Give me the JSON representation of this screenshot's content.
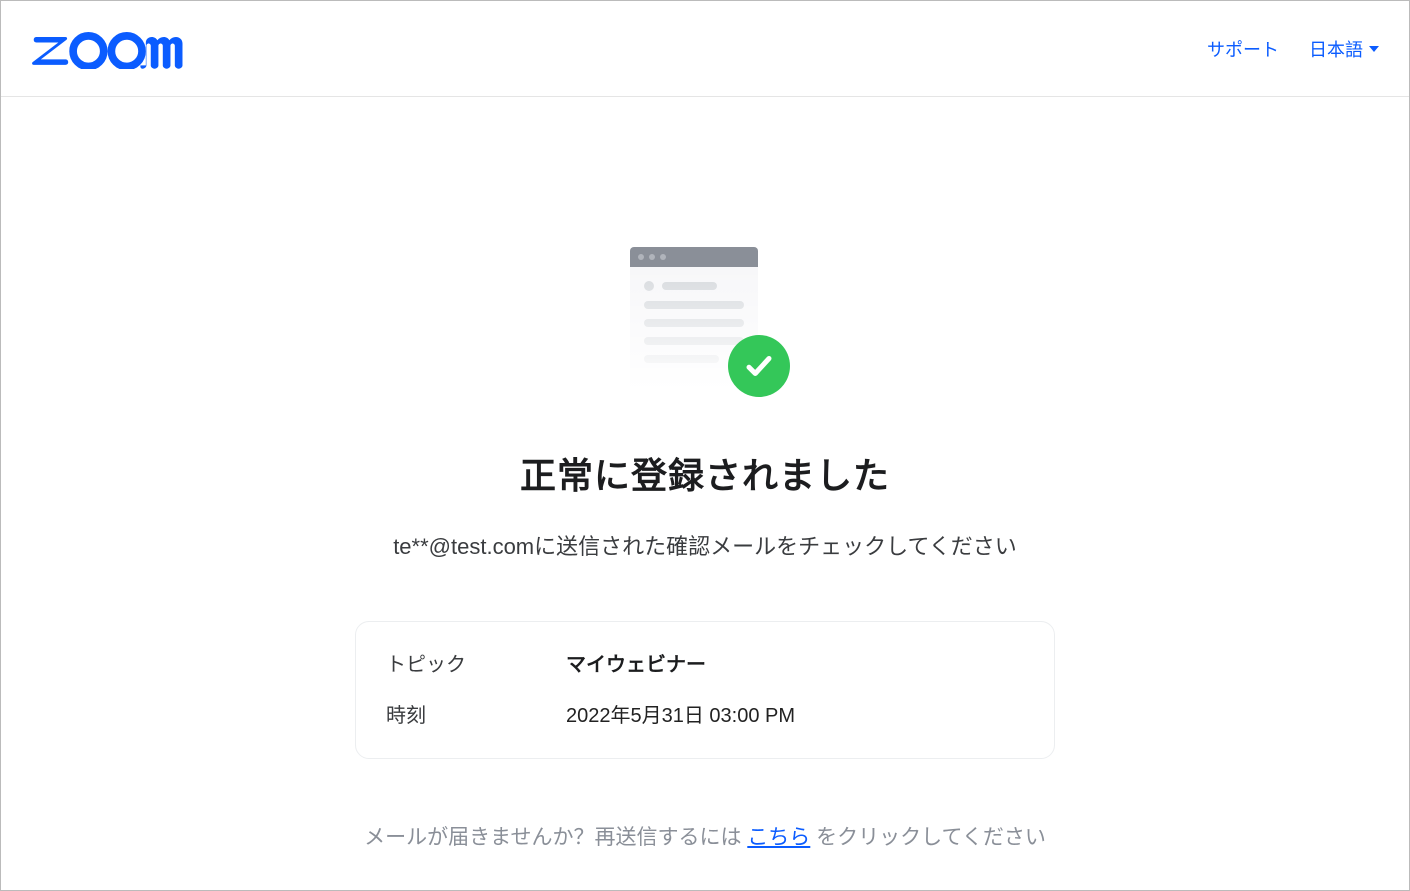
{
  "header": {
    "support": "サポート",
    "language": "日本語"
  },
  "page": {
    "title": "正常に登録されました",
    "subtitle": "te**@test.comに送信された確認メールをチェックしてください"
  },
  "info": {
    "topic_label": "トピック",
    "topic_value": "マイウェビナー",
    "time_label": "時刻",
    "time_value": "2022年5月31日 03:00 PM"
  },
  "resend": {
    "prefix": "メールが届きませんか？再送信するには ",
    "link": "こちら",
    "suffix": " をクリックしてください"
  }
}
